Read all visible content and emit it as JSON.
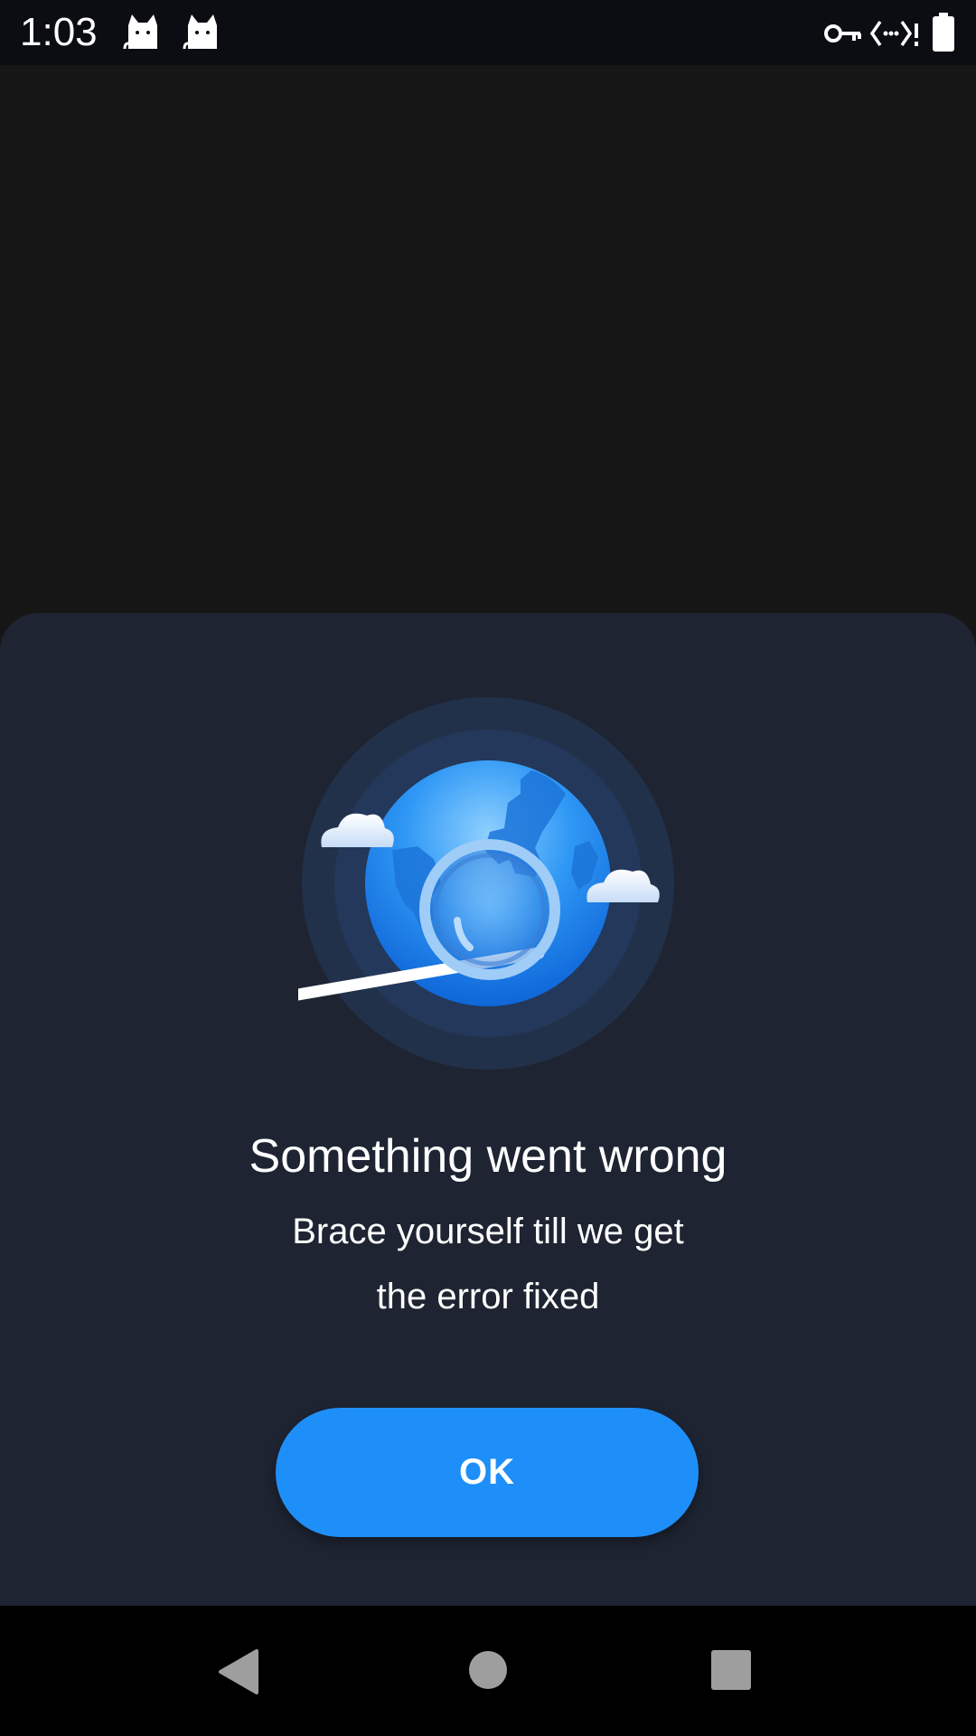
{
  "status_bar": {
    "time": "1:03",
    "left_icons": [
      "cat-notification-icon",
      "cat-notification-icon"
    ],
    "right_icons": [
      "vpn-key-icon",
      "data-saver-icon",
      "battery-full-icon"
    ]
  },
  "dialog": {
    "illustration_icon": "globe-magnifier-illustration",
    "title": "Something went wrong",
    "message": "Brace yourself till we get the error fixed",
    "ok_label": "OK"
  },
  "nav_bar": {
    "buttons": [
      "back-icon",
      "home-icon",
      "recents-icon"
    ]
  },
  "colors": {
    "status_bar_bg": "#0b0d12",
    "app_bg": "#161616",
    "sheet_bg": "#1e2432",
    "accent": "#1e8ff8",
    "nav_bar_bg": "#000000",
    "text": "#ffffff"
  }
}
